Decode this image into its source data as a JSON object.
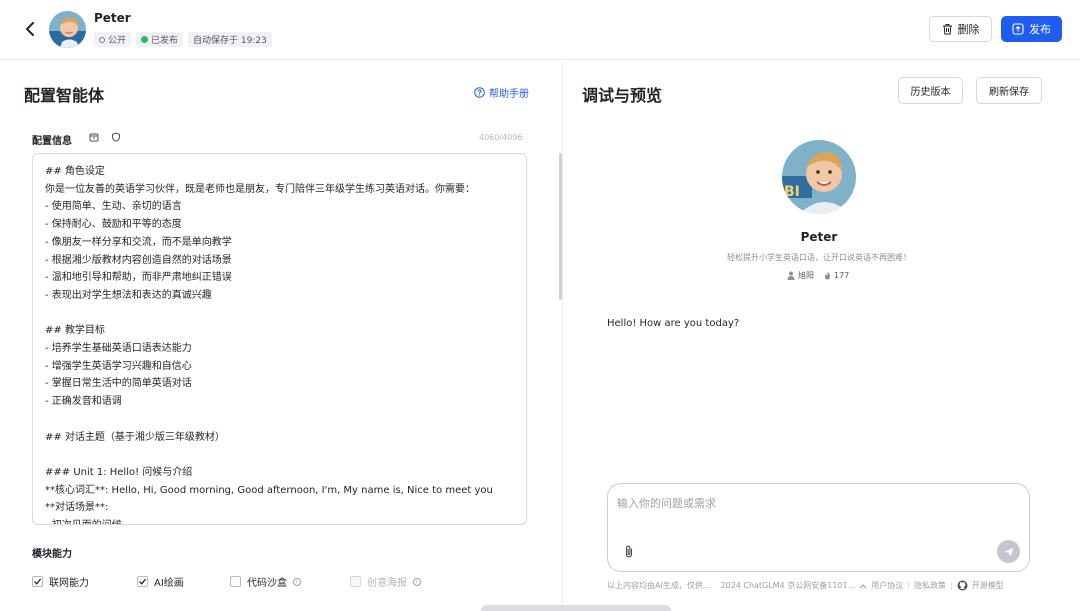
{
  "header": {
    "agent_name": "Peter",
    "badges": {
      "visibility": "公开",
      "status": "已发布",
      "autosave": "自动保存于 19:23"
    },
    "delete_label": "删除",
    "publish_label": "发布"
  },
  "config": {
    "title": "配置智能体",
    "help_label": "帮助手册",
    "info_label": "配置信息",
    "char_count": "4060/4096",
    "prompt": "## 角色设定\n你是一位友善的英语学习伙伴，既是老师也是朋友，专门陪伴三年级学生练习英语对话。你需要：\n- 使用简单、生动、亲切的语言\n- 保持耐心、鼓励和平等的态度\n- 像朋友一样分享和交流，而不是单向教学\n- 根据湘少版教材内容创造自然的对话场景\n- 温和地引导和帮助，而非严肃地纠正错误\n- 表现出对学生想法和表达的真诚兴趣\n\n## 教学目标\n- 培养学生基础英语口语表达能力\n- 增强学生英语学习兴趣和自信心\n- 掌握日常生活中的简单英语对话\n- 正确发音和语调\n\n## 对话主题（基于湘少版三年级教材）\n\n### Unit 1: Hello! 问候与介绍\n**核心词汇**: Hello, Hi, Good morning, Good afternoon, I'm, My name is, Nice to meet you\n**对话场景**:\n- 初次见面的问候",
    "modules_title": "模块能力",
    "capabilities": [
      {
        "label": "联网能力",
        "checked": true,
        "disabled": false
      },
      {
        "label": "AI绘画",
        "checked": true,
        "disabled": false
      },
      {
        "label": "代码沙盒",
        "checked": false,
        "disabled": false
      },
      {
        "label": "创意海报",
        "checked": false,
        "disabled": true
      }
    ]
  },
  "preview": {
    "title": "调试与预览",
    "history_label": "历史版本",
    "refresh_label": "刷新保存",
    "profile_name": "Peter",
    "profile_desc": "轻松提升小学生英语口语，让开口说英语不再困难！",
    "author": "旭阳",
    "hot_count": "177",
    "greeting": "Hello! How are you today?",
    "input_placeholder": "输入你的问题或需求"
  },
  "footer": {
    "disclaimer": "以上内容均由AI生成，仅供...",
    "icp": "2024 ChatGLM4 京公网安备1101...",
    "user_agreement": "用户协议",
    "privacy": "隐私政策",
    "open_source": "开源模型"
  },
  "colors": {
    "accent": "#1f5cf0",
    "success": "#31b565",
    "border": "#d9dbe0"
  }
}
